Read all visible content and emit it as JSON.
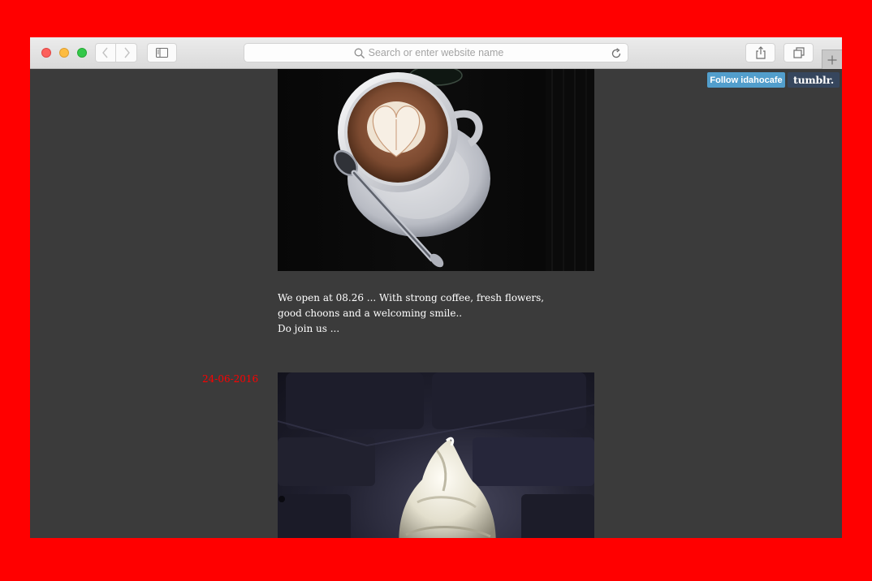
{
  "browser": {
    "address_placeholder": "Search or enter website name"
  },
  "tumblr_controls": {
    "follow_label": "Follow idahocafe",
    "logo_text": "tumblr."
  },
  "posts": [
    {
      "image": "latte-art-coffee-cup",
      "caption_lines": [
        "We open at 08.26 ... With strong coffee, fresh flowers, good choons and a welcoming smile..",
        "Do join us ..."
      ]
    },
    {
      "date": "24-06-2016",
      "image": "soft-serve-ice-cream"
    }
  ],
  "colors": {
    "page_background": "#ff0000",
    "content_background": "#3b3b3b",
    "date_color": "#ff0000",
    "follow_button": "#529ecc",
    "tumblr_logo": "#36465d"
  }
}
